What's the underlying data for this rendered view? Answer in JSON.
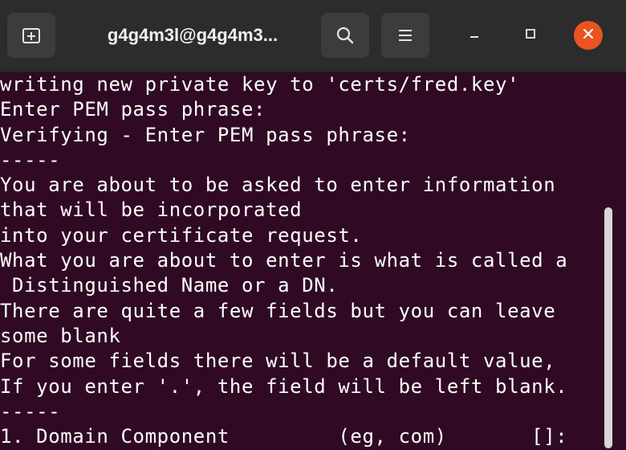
{
  "titlebar": {
    "title": "g4g4m3l@g4g4m3...",
    "new_tab_icon": "new-tab-icon",
    "search_icon": "search-icon",
    "menu_icon": "hamburger-menu-icon",
    "minimize_icon": "minimize-icon",
    "maximize_icon": "maximize-icon",
    "close_icon": "close-icon"
  },
  "colors": {
    "terminal_background": "#300a24",
    "terminal_text": "#ffffff",
    "titlebar_background": "#2c2c2c",
    "close_button": "#e95420"
  },
  "terminal": {
    "lines": [
      "writing new private key to 'certs/fred.key'",
      "Enter PEM pass phrase:",
      "Verifying - Enter PEM pass phrase:",
      "-----",
      "You are about to be asked to enter information",
      "that will be incorporated",
      "into your certificate request.",
      "What you are about to enter is what is called a",
      " Distinguished Name or a DN.",
      "There are quite a few fields but you can leave",
      "some blank",
      "For some fields there will be a default value,",
      "If you enter '.', the field will be left blank.",
      "-----",
      "1. Domain Component         (eg, com)       []:"
    ]
  }
}
